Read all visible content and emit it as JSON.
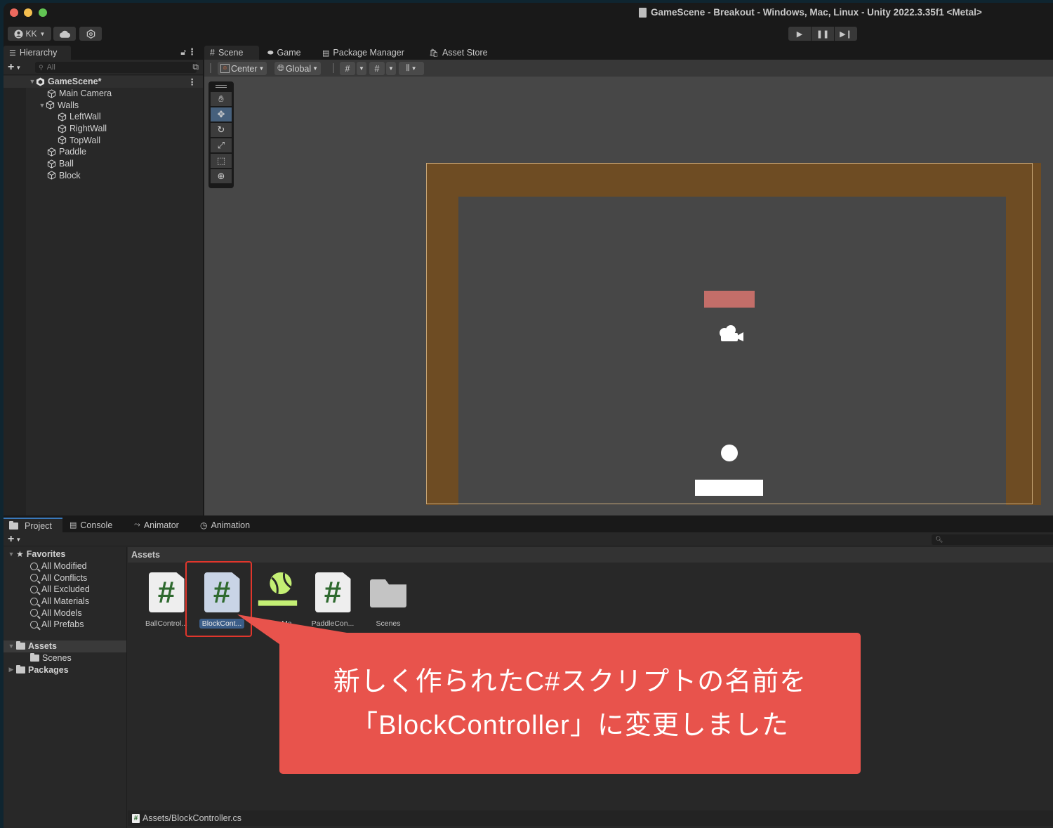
{
  "window": {
    "title": "GameScene - Breakout - Windows, Mac, Linux - Unity 2022.3.35f1 <Metal>"
  },
  "toolbar": {
    "account_label": "KK",
    "icons": [
      "account-icon",
      "cloud-icon",
      "collab-icon"
    ],
    "play_controls": [
      "play-icon",
      "pause-icon",
      "step-icon"
    ]
  },
  "hierarchy": {
    "tab_label": "Hierarchy",
    "search_placeholder": "All",
    "scene": {
      "name": "GameScene*"
    },
    "items": [
      {
        "label": "Main Camera",
        "depth": 1,
        "expanded": null
      },
      {
        "label": "Walls",
        "depth": 1,
        "expanded": true
      },
      {
        "label": "LeftWall",
        "depth": 2,
        "expanded": null
      },
      {
        "label": "RightWall",
        "depth": 2,
        "expanded": null
      },
      {
        "label": "TopWall",
        "depth": 2,
        "expanded": null
      },
      {
        "label": "Paddle",
        "depth": 1,
        "expanded": null
      },
      {
        "label": "Ball",
        "depth": 1,
        "expanded": null
      },
      {
        "label": "Block",
        "depth": 1,
        "expanded": null
      }
    ]
  },
  "scene_panel": {
    "tabs": [
      {
        "label": "Scene",
        "icon": "grid-icon",
        "active": true
      },
      {
        "label": "Game",
        "icon": "gamepad-icon",
        "active": false
      },
      {
        "label": "Package Manager",
        "icon": "package-icon",
        "active": false
      },
      {
        "label": "Asset Store",
        "icon": "store-bag-icon",
        "active": false
      }
    ],
    "toolbar": {
      "pivot_label": "Center",
      "space_label": "Global"
    },
    "tools": [
      "hand-tool",
      "move-tool",
      "rotate-tool",
      "scale-tool",
      "rect-tool",
      "transform-tool"
    ],
    "active_tool": "move-tool",
    "colors": {
      "wall": "#6e4c23",
      "block": "#c36e69",
      "ball": "#ffffff",
      "paddle": "#ffffff",
      "background": "#474747"
    }
  },
  "bottom_panel": {
    "tabs": [
      {
        "label": "Project",
        "active": true
      },
      {
        "label": "Console",
        "active": false
      },
      {
        "label": "Animator",
        "active": false
      },
      {
        "label": "Animation",
        "active": false
      }
    ],
    "search_placeholder": "",
    "tree": {
      "favorites_label": "Favorites",
      "favorites": [
        "All Modified",
        "All Conflicts",
        "All Excluded",
        "All Materials",
        "All Models",
        "All Prefabs"
      ],
      "assets_label": "Assets",
      "assets_children": [
        "Scenes"
      ],
      "packages_label": "Packages"
    },
    "breadcrumb": "Assets",
    "assets": [
      {
        "label": "BallControl...",
        "type": "script",
        "selected": false
      },
      {
        "label": "BlockCont...",
        "type": "script",
        "selected": true
      },
      {
        "label": "BounceMa...",
        "type": "physics-material",
        "selected": false
      },
      {
        "label": "PaddleCon...",
        "type": "script",
        "selected": false
      },
      {
        "label": "Scenes",
        "type": "folder",
        "selected": false
      }
    ],
    "status_path": "Assets/BlockController.cs"
  },
  "annotation": {
    "line1": "新しく作られたC#スクリプトの名前を",
    "line2": "「BlockController」に変更しました",
    "color": "#e8534c",
    "highlight_color": "#e1362c"
  }
}
